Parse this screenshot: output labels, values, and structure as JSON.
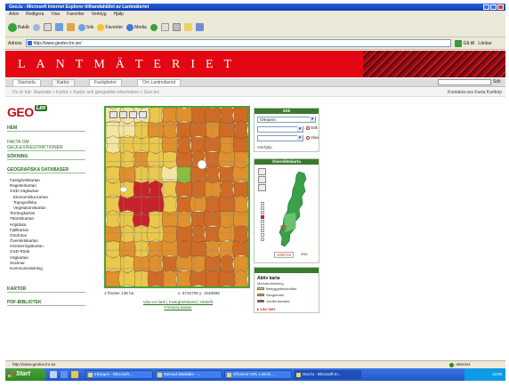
{
  "browser": {
    "title": "Geo.lu - Microsoft Internet Explorer tillhandahållet av Lantmäteriet",
    "menu": [
      "Arkiv",
      "Redigera",
      "Visa",
      "Favoriter",
      "Verktyg",
      "Hjälp"
    ],
    "toolbar": {
      "back": "Bakåt",
      "search": "Sök",
      "favorites": "Favoriter",
      "media": "Media"
    },
    "address_label": "Adress",
    "address": "http://www.geolex.lm.se/",
    "go": "Gå till",
    "links": "Länkar"
  },
  "site": {
    "logo": "LANTMÄTERIET",
    "tabs": [
      "Startsida",
      "Kartor",
      "Fastigheter",
      "Om Lantmäteriet"
    ],
    "active_tab": 1,
    "search_button": "Sök",
    "breadcrumb": "Du är här: Startsida > Kartor > Kartor och geografisk information > Geo.lex",
    "utility_links": "Kontakta oss   Karta   Kartköp"
  },
  "left": {
    "logo_main": "GEO",
    "logo_suffix": "Lex",
    "heading_home": "HEM",
    "link_about": "FAKTA OM GEOLEX/RESTRIKTIONER",
    "heading_search": "SÖKNING",
    "heading_db": "GEOGRAFISKA DATABASER",
    "db_items": [
      "Fastighetskartan",
      "Registerkartan",
      "GSD-Vägkartan",
      "Ekonomiska kartan",
      "Topografiska",
      "Vegetationskartan",
      "Terrängkartan",
      "Tätortskartan",
      "Höjddata",
      "Fjällkartan",
      "Ortofoton",
      "Översiktskartan",
      "Orienteringskartan",
      "GSD-Röda",
      "Vägkartan",
      "Socknar",
      "Kommunindelning"
    ],
    "db_indented": [
      3,
      4,
      5
    ],
    "heading_maps": "KARTOR",
    "heading_library": "PDF-BIBLIOTEK"
  },
  "map": {
    "scale_text": "1 fönster 138 ha",
    "coords_text": "x: 6732709 y: 1548898",
    "footer_links": [
      "Visa en länk",
      "Fastighetskarta",
      "Utskrift",
      "Förstora kartan"
    ],
    "colors": {
      "pale": "#f2e6a3",
      "light": "#e9c84b",
      "mid": "#e0902d",
      "dark": "#d06a24",
      "red": "#c8222a",
      "green": "#8bbe3f",
      "grid": "#888888",
      "frame": "#48a33d"
    }
  },
  "search": {
    "title": "Sök",
    "select1": "Ortnamn",
    "select2": "",
    "radio1": "Sök",
    "radio2": "Visa",
    "help": "Sökhjälp"
  },
  "overview": {
    "title": "Översiktskarta",
    "scale": "1000 km",
    "link": "visa"
  },
  "legend": {
    "title": "Aktiv karta",
    "subtitle": "Markanvändning",
    "rows": [
      "Bebyggelseområde",
      "Skogsmark",
      "Jordbruksmark"
    ],
    "row_colors": [
      "#e9c84b",
      "#e0902d",
      "#c8222a"
    ],
    "link": "Läs mer"
  },
  "status": {
    "text": "http://www.geolex.lm.se",
    "zone": "Internet"
  },
  "taskbar": {
    "start": "Start",
    "buttons": [
      "Inkorgen - Microsoft...",
      "Saknad datakälla - ...",
      "Oficinenr-URL-Lösnin...",
      "Geo.lu - Microsoft In..."
    ],
    "active": 3,
    "clock": "13:36"
  }
}
